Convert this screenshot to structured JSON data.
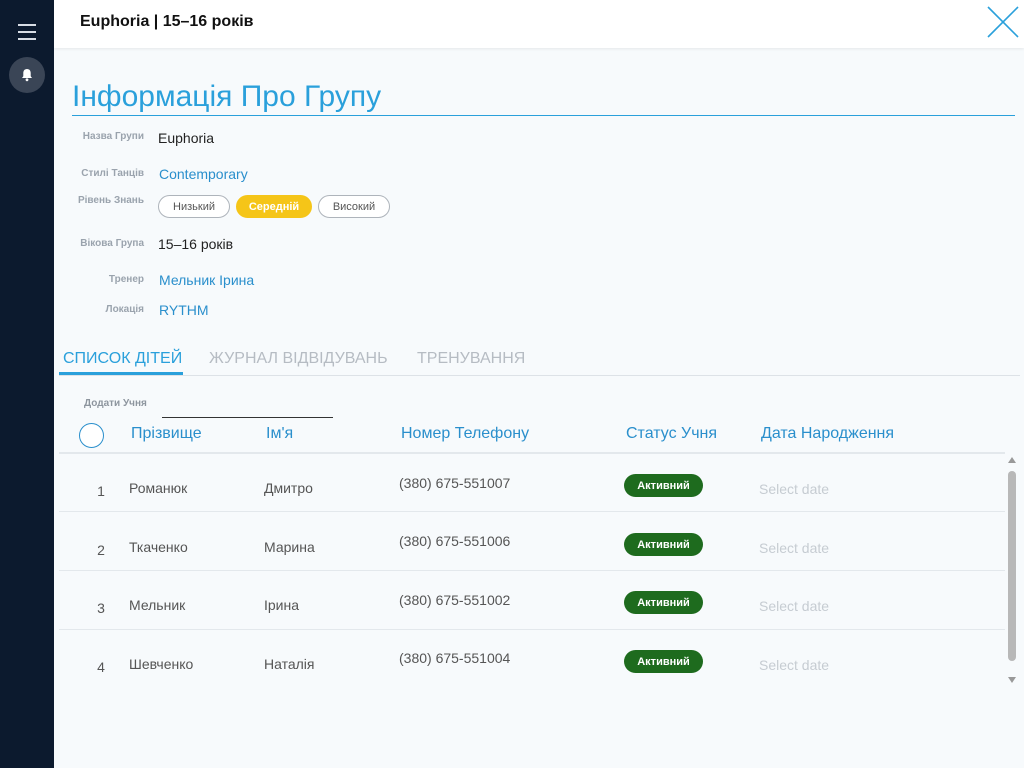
{
  "header": {
    "title": "Euphoria | 15–16 років",
    "menu_icon": "hamburger-icon",
    "notification_icon": "bell-icon",
    "close_icon": "close-icon"
  },
  "info": {
    "section_title": "Інформація Про Групу",
    "fields": {
      "name": {
        "label": "Назва Групи",
        "value": "Euphoria"
      },
      "styles": {
        "label": "Стилі Танців",
        "value": "Contemporary"
      },
      "level": {
        "label": "Рівень Знань",
        "options": [
          "Низький",
          "Середній",
          "Високий"
        ],
        "selected": "Середній"
      },
      "age": {
        "label": "Вікова Група",
        "value": "15–16 років"
      },
      "coach": {
        "label": "Тренер",
        "value": "Мельник Ірина"
      },
      "location": {
        "label": "Локація",
        "value": "RYTHM"
      }
    }
  },
  "tabs": [
    {
      "label": "СПИСОК ДІТЕЙ",
      "active": true
    },
    {
      "label": "ЖУРНАЛ ВІДВІДУВАНЬ",
      "active": false
    },
    {
      "label": "ТРЕНУВАННЯ",
      "active": false
    }
  ],
  "students": {
    "add_label": "Додати Учня",
    "add_value": "",
    "columns": [
      "Прізвище",
      "Ім'я",
      "Номер Телефону",
      "Статус Учня",
      "Дата Народження"
    ],
    "rows": [
      {
        "num": "1",
        "surname": "Романюк",
        "name": "Дмитро",
        "phone": "(380) 675-551007",
        "status": "Активний",
        "dob_placeholder": "Select date"
      },
      {
        "num": "2",
        "surname": "Ткаченко",
        "name": "Марина",
        "phone": "(380) 675-551006",
        "status": "Активний",
        "dob_placeholder": "Select date"
      },
      {
        "num": "3",
        "surname": "Мельник",
        "name": "Ірина",
        "phone": "(380) 675-551002",
        "status": "Активний",
        "dob_placeholder": "Select date"
      },
      {
        "num": "4",
        "surname": "Шевченко",
        "name": "Наталія",
        "phone": "(380) 675-551004",
        "status": "Активний",
        "dob_placeholder": "Select date"
      }
    ]
  },
  "colors": {
    "sidebar": "#0c1a2e",
    "accent": "#2aa0db",
    "link": "#2a8fcc",
    "selected_level": "#f5c518",
    "status_active": "#1e6b1e"
  }
}
